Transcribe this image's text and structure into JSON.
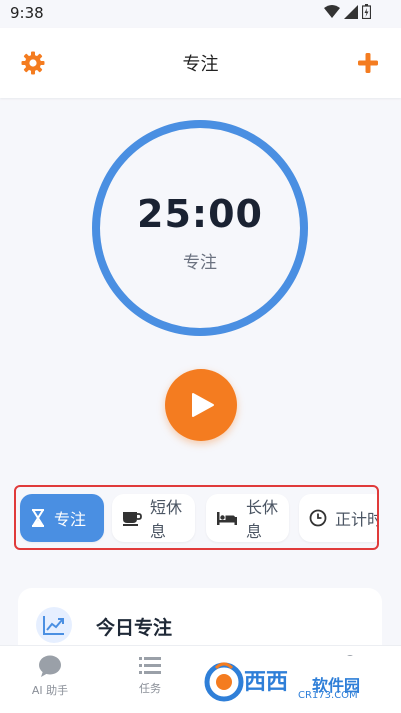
{
  "status_bar": {
    "time": "9:38"
  },
  "app_bar": {
    "title": "专注"
  },
  "timer": {
    "time": "25:00",
    "mode_label": "专注",
    "progress": 1.0
  },
  "mode_tabs": [
    {
      "label": "专注",
      "icon": "hourglass-icon",
      "active": true
    },
    {
      "label": "短休息",
      "icon": "coffee-cup-icon",
      "active": false
    },
    {
      "label": "长休息",
      "icon": "bed-icon",
      "active": false
    },
    {
      "label": "正计时",
      "icon": "clock-icon",
      "active": false
    }
  ],
  "today_card": {
    "title": "今日专注"
  },
  "bottom_nav": [
    {
      "label": "AI 助手",
      "icon": "chat-bubble-icon"
    },
    {
      "label": "任务",
      "icon": "list-icon"
    }
  ],
  "watermark": {
    "text": "西西",
    "sub": "软件园",
    "url": "CR173.COM"
  },
  "colors": {
    "accent_blue": "#4a8fe2",
    "accent_orange": "#f47c20",
    "highlight_red": "#e03a3a"
  }
}
